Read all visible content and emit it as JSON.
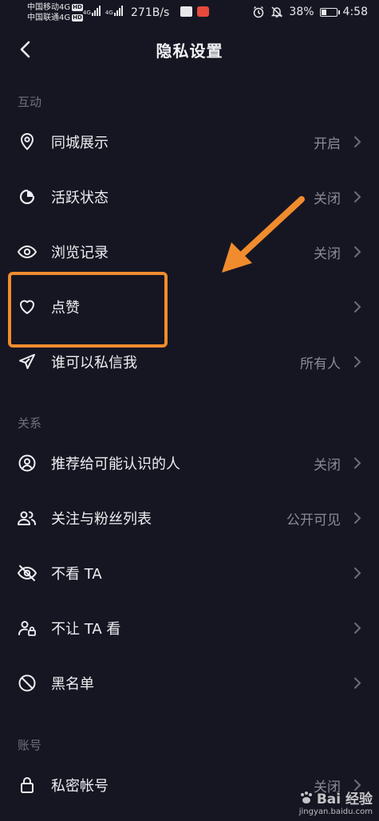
{
  "status_bar": {
    "carrier_1": "中国移动4G",
    "carrier_2": "中国联通4G",
    "hd_badge": "HD",
    "net_1": "4G",
    "net_2": "4G",
    "speed": "271B/s",
    "battery_pct": "38%",
    "battery_level": 0.38,
    "time": "4:58"
  },
  "nav": {
    "title": "隐私设置",
    "back_icon": "chevron-left-icon"
  },
  "sections": {
    "interaction": "互动",
    "relations": "关系",
    "account": "账号"
  },
  "rows": {
    "same_city": {
      "label": "同城展示",
      "value": "开启",
      "icon": "location-pin-icon"
    },
    "active_status": {
      "label": "活跃状态",
      "value": "关闭",
      "icon": "active-status-icon"
    },
    "browse_history": {
      "label": "浏览记录",
      "value": "关闭",
      "icon": "eye-icon"
    },
    "likes": {
      "label": "点赞",
      "value": "",
      "icon": "heart-icon"
    },
    "private_msg": {
      "label": "谁可以私信我",
      "value": "所有人",
      "icon": "paper-plane-icon"
    },
    "recommend": {
      "label": "推荐给可能认识的人",
      "value": "关闭",
      "icon": "user-circle-icon"
    },
    "follow_list": {
      "label": "关注与粉丝列表",
      "value": "公开可见",
      "icon": "users-icon"
    },
    "not_see": {
      "label": "不看 TA",
      "value": "",
      "icon": "eye-off-icon"
    },
    "not_let_see": {
      "label": "不让 TA 看",
      "value": "",
      "icon": "user-lock-icon"
    },
    "blacklist": {
      "label": "黑名单",
      "value": "",
      "icon": "block-icon"
    },
    "private_account": {
      "label": "私密帐号",
      "value": "关闭",
      "icon": "lock-icon"
    }
  },
  "annotation": {
    "arrow_color": "#f08c2e",
    "box_color": "#f08c2e"
  },
  "watermark": {
    "logo": "Bai 经验",
    "url": "jingyan.baidu.com"
  },
  "colors": {
    "background": "#161622",
    "text": "#ededf2",
    "secondary": "#8a8a96",
    "section": "#70707e"
  }
}
